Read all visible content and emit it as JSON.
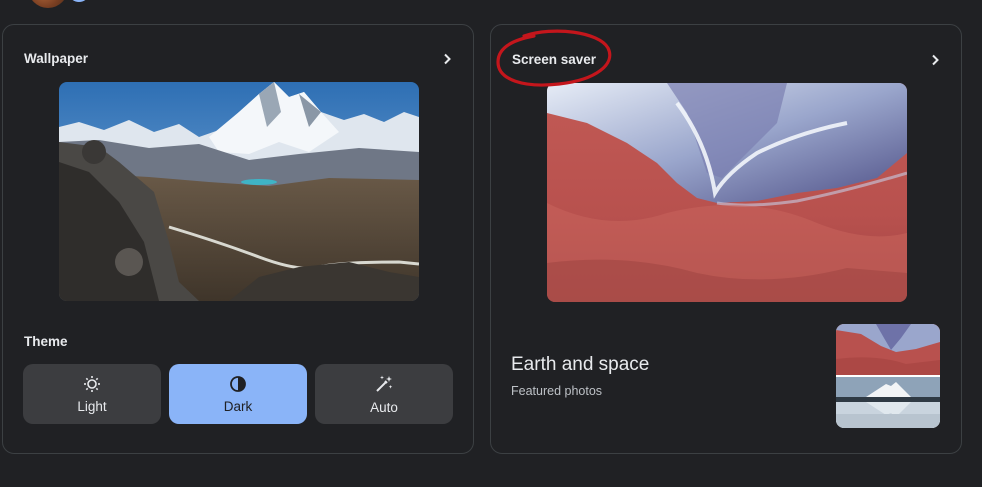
{
  "wallpaper": {
    "title": "Wallpaper"
  },
  "screensaver": {
    "title": "Screen saver",
    "album_title": "Earth and space",
    "album_subtitle": "Featured photos"
  },
  "theme": {
    "label": "Theme",
    "options": [
      {
        "label": "Light",
        "icon": "brightness-icon",
        "selected": false
      },
      {
        "label": "Dark",
        "icon": "contrast-icon",
        "selected": true
      },
      {
        "label": "Auto",
        "icon": "magic-wand-icon",
        "selected": false
      }
    ]
  },
  "colors": {
    "background": "#202124",
    "accent": "#8ab4f8",
    "button": "#3c3d40",
    "annotation": "#c4161c"
  }
}
